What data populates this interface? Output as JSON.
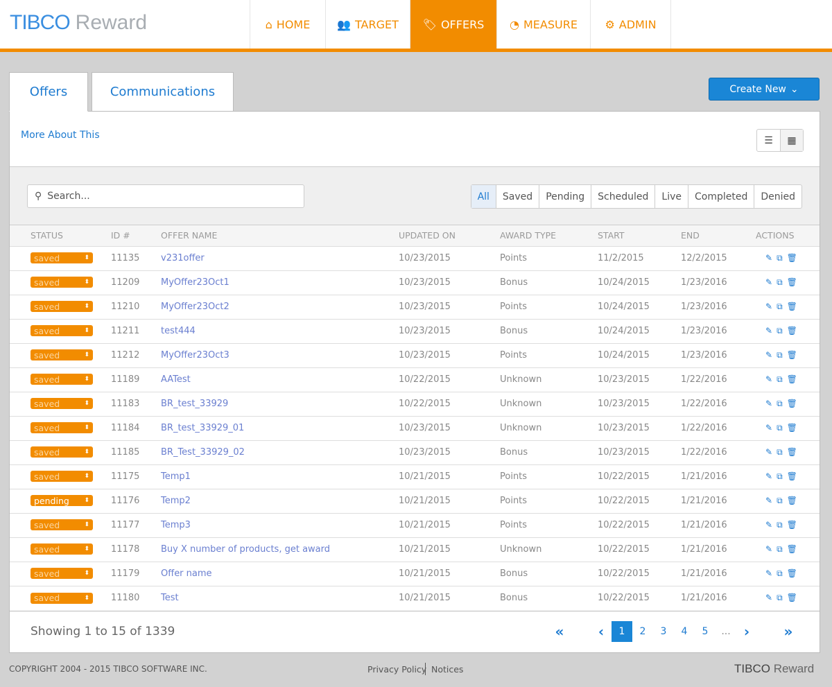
{
  "brand": {
    "logo_main": "TIBCO",
    "logo_product": "Reward"
  },
  "nav": [
    {
      "label": "HOME",
      "icon": "home-icon"
    },
    {
      "label": "TARGET",
      "icon": "users-icon"
    },
    {
      "label": "OFFERS",
      "icon": "tags-icon",
      "active": true
    },
    {
      "label": "MEASURE",
      "icon": "dashboard-icon"
    },
    {
      "label": "ADMIN",
      "icon": "cogs-icon"
    }
  ],
  "tabs": [
    {
      "label": "Offers",
      "active": true
    },
    {
      "label": "Communications"
    }
  ],
  "create_new": "Create New",
  "more_about": "More About This",
  "search": {
    "placeholder": "Search..."
  },
  "filters": [
    "All",
    "Saved",
    "Pending",
    "Scheduled",
    "Live",
    "Completed",
    "Denied"
  ],
  "columns": [
    "STATUS",
    "ID #",
    "OFFER NAME",
    "UPDATED ON",
    "AWARD TYPE",
    "START",
    "END",
    "ACTIONS"
  ],
  "rows": [
    [
      "saved",
      "11135",
      "v231offer",
      "10/23/2015",
      "Points",
      "11/2/2015",
      "12/2/2015"
    ],
    [
      "saved",
      "11209",
      "MyOffer23Oct1",
      "10/23/2015",
      "Bonus",
      "10/24/2015",
      "1/23/2016"
    ],
    [
      "saved",
      "11210",
      "MyOffer23Oct2",
      "10/23/2015",
      "Points",
      "10/24/2015",
      "1/23/2016"
    ],
    [
      "saved",
      "11211",
      "test444",
      "10/23/2015",
      "Bonus",
      "10/24/2015",
      "1/23/2016"
    ],
    [
      "saved",
      "11212",
      "MyOffer23Oct3",
      "10/23/2015",
      "Points",
      "10/24/2015",
      "1/23/2016"
    ],
    [
      "saved",
      "11189",
      "AATest",
      "10/22/2015",
      "Unknown",
      "10/23/2015",
      "1/22/2016"
    ],
    [
      "saved",
      "11183",
      "BR_test_33929",
      "10/22/2015",
      "Unknown",
      "10/23/2015",
      "1/22/2016"
    ],
    [
      "saved",
      "11184",
      "BR_test_33929_01",
      "10/23/2015",
      "Unknown",
      "10/23/2015",
      "1/22/2016"
    ],
    [
      "saved",
      "11185",
      "BR_Test_33929_02",
      "10/23/2015",
      "Bonus",
      "10/23/2015",
      "1/22/2016"
    ],
    [
      "saved",
      "11175",
      "Temp1",
      "10/21/2015",
      "Points",
      "10/22/2015",
      "1/21/2016"
    ],
    [
      "pending",
      "11176",
      "Temp2",
      "10/21/2015",
      "Points",
      "10/22/2015",
      "1/21/2016"
    ],
    [
      "saved",
      "11177",
      "Temp3",
      "10/21/2015",
      "Points",
      "10/22/2015",
      "1/21/2016"
    ],
    [
      "saved",
      "11178",
      "Buy X number of products, get award",
      "10/21/2015",
      "Unknown",
      "10/22/2015",
      "1/21/2016"
    ],
    [
      "saved",
      "11179",
      "Offer name",
      "10/21/2015",
      "Bonus",
      "10/22/2015",
      "1/21/2016"
    ],
    [
      "saved",
      "11180",
      "Test",
      "10/21/2015",
      "Bonus",
      "10/22/2015",
      "1/21/2016"
    ]
  ],
  "showing": "Showing 1 to 15 of 1339",
  "pager": {
    "first": "«",
    "prev": "‹",
    "pages": [
      "1",
      "2",
      "3",
      "4",
      "5",
      "..."
    ],
    "current": "1",
    "next": "›",
    "last": "»"
  },
  "footer": {
    "copyright": "COPYRIGHT 2004 - 2015 TIBCO SOFTWARE INC.",
    "privacy": "Privacy Policy",
    "notices": "Notices",
    "logo_main": "TIBCO",
    "logo_product": "Reward"
  },
  "colors": {
    "accent": "#f28c00",
    "primary": "#1a86d6"
  }
}
